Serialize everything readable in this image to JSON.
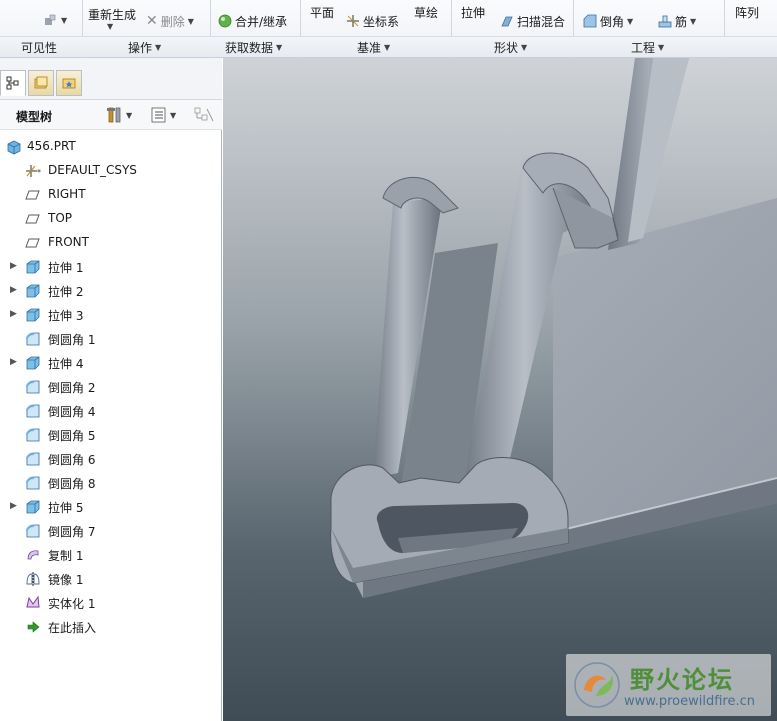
{
  "ribbon": {
    "top_row": {
      "regenerate": "重新生成",
      "delete": "删除",
      "merge_inherit": "合并/继承",
      "plane": "平面",
      "csys": "坐标系",
      "sketch": "草绘",
      "extrude": "拉伸",
      "sweep_blend": "扫描混合",
      "chamfer": "倒角",
      "rib": "筋",
      "pattern": "阵列"
    },
    "groups": {
      "visibility": "可见性",
      "operations": "操作",
      "get_data": "获取数据",
      "datum": "基准",
      "shapes": "形状",
      "engineering": "工程"
    }
  },
  "panel": {
    "tree_title": "模型树"
  },
  "tree": {
    "items": [
      {
        "label": "456.PRT",
        "icon": "part-icon",
        "expandable": false
      },
      {
        "label": "DEFAULT_CSYS",
        "icon": "csys-icon",
        "expandable": false
      },
      {
        "label": "RIGHT",
        "icon": "datum-plane-icon",
        "expandable": false
      },
      {
        "label": "TOP",
        "icon": "datum-plane-icon",
        "expandable": false
      },
      {
        "label": "FRONT",
        "icon": "datum-plane-icon",
        "expandable": false
      },
      {
        "label": "拉伸 1",
        "icon": "extrude-icon",
        "expandable": true
      },
      {
        "label": "拉伸 2",
        "icon": "extrude-icon",
        "expandable": true
      },
      {
        "label": "拉伸 3",
        "icon": "extrude-icon",
        "expandable": true
      },
      {
        "label": "倒圆角 1",
        "icon": "round-icon",
        "expandable": false
      },
      {
        "label": "拉伸 4",
        "icon": "extrude-icon",
        "expandable": true
      },
      {
        "label": "倒圆角 2",
        "icon": "round-icon",
        "expandable": false
      },
      {
        "label": "倒圆角 4",
        "icon": "round-icon",
        "expandable": false
      },
      {
        "label": "倒圆角 5",
        "icon": "round-icon",
        "expandable": false
      },
      {
        "label": "倒圆角 6",
        "icon": "round-icon",
        "expandable": false
      },
      {
        "label": "倒圆角 8",
        "icon": "round-icon",
        "expandable": false
      },
      {
        "label": "拉伸 5",
        "icon": "extrude-icon",
        "expandable": true
      },
      {
        "label": "倒圆角 7",
        "icon": "round-icon",
        "expandable": false
      },
      {
        "label": "复制 1",
        "icon": "copy-icon",
        "expandable": false
      },
      {
        "label": "镜像 1",
        "icon": "mirror-icon",
        "expandable": false
      },
      {
        "label": "实体化 1",
        "icon": "solidify-icon",
        "expandable": false
      },
      {
        "label": "在此插入",
        "icon": "insert-here-arrow-icon",
        "expandable": false
      }
    ]
  },
  "watermark": {
    "title": "野火论坛",
    "url": "www.proewildfire.cn"
  },
  "colors": {
    "model_fill": "#8d949e",
    "model_light": "#b4bac3",
    "model_dark": "#555d68",
    "accent_green": "#4f8f3a"
  }
}
